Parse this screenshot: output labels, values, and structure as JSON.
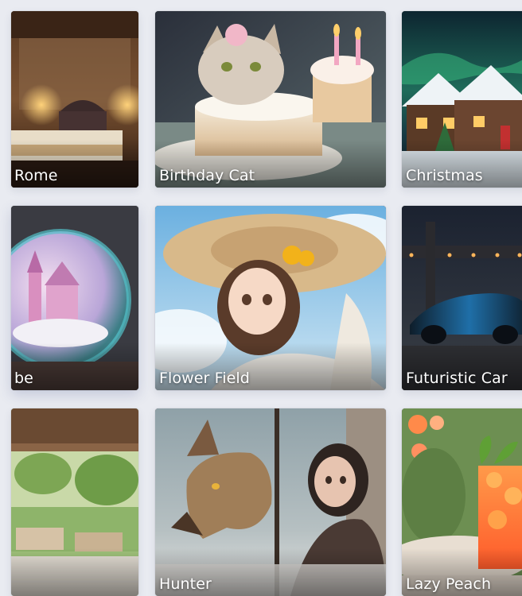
{
  "gallery": {
    "cards": [
      {
        "label": "Rome",
        "icon": "bedroom-scene"
      },
      {
        "label": "Birthday Cat",
        "icon": "cat-cake-scene"
      },
      {
        "label": "Christmas",
        "icon": "snowy-house-scene"
      },
      {
        "label": "be",
        "icon": "snow-globe-scene"
      },
      {
        "label": "Flower Field",
        "icon": "girl-straw-hat-scene"
      },
      {
        "label": "Futuristic Car",
        "icon": "car-bridge-scene"
      },
      {
        "label": "",
        "icon": "patio-scene"
      },
      {
        "label": "Hunter",
        "icon": "wolf-hunter-scene"
      },
      {
        "label": "Lazy Peach",
        "icon": "peach-drink-scene"
      }
    ]
  }
}
